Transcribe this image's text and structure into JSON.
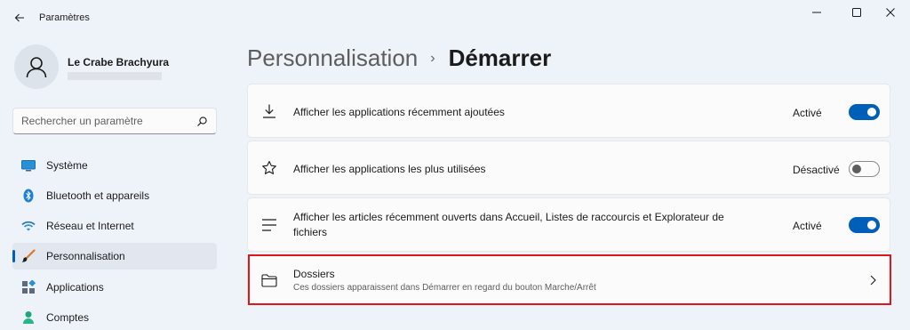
{
  "window": {
    "title": "Paramètres",
    "back_icon": "back-arrow-icon",
    "controls": [
      "minimize-icon",
      "maximize-icon",
      "close-icon"
    ]
  },
  "user": {
    "name": "Le Crabe Brachyura",
    "avatar_icon": "user-avatar-icon"
  },
  "search": {
    "placeholder": "Rechercher un paramètre",
    "value": "",
    "icon": "search-icon"
  },
  "nav": [
    {
      "label": "Système",
      "icon": "monitor-icon",
      "selected": false
    },
    {
      "label": "Bluetooth et appareils",
      "icon": "bluetooth-icon",
      "selected": false
    },
    {
      "label": "Réseau et Internet",
      "icon": "wifi-icon",
      "selected": false
    },
    {
      "label": "Personnalisation",
      "icon": "brush-icon",
      "selected": true
    },
    {
      "label": "Applications",
      "icon": "apps-icon",
      "selected": false
    },
    {
      "label": "Comptes",
      "icon": "account-icon",
      "selected": false
    }
  ],
  "breadcrumb": {
    "parent": "Personnalisation",
    "separator": "›",
    "current": "Démarrer"
  },
  "settings": [
    {
      "title": "Afficher les applications récemment ajoutées",
      "state": "Activé",
      "on": true,
      "icon": "download-icon"
    },
    {
      "title": "Afficher les applications les plus utilisées",
      "state": "Désactivé",
      "on": false,
      "icon": "star-icon"
    },
    {
      "title": "Afficher les articles récemment ouverts dans Accueil, Listes de raccourcis et Explorateur de fichiers",
      "state": "Activé",
      "on": true,
      "icon": "list-icon"
    },
    {
      "title": "Dossiers",
      "description": "Ces dossiers apparaissent dans Démarrer en regard du bouton Marche/Arrêt",
      "icon": "folder-icon",
      "chevron_icon": "chevron-right-icon"
    }
  ],
  "colors": {
    "accent": "#005fb8",
    "highlight_border": "#e0161d",
    "background": "#eef2f9",
    "card": "#fbfbfc"
  }
}
